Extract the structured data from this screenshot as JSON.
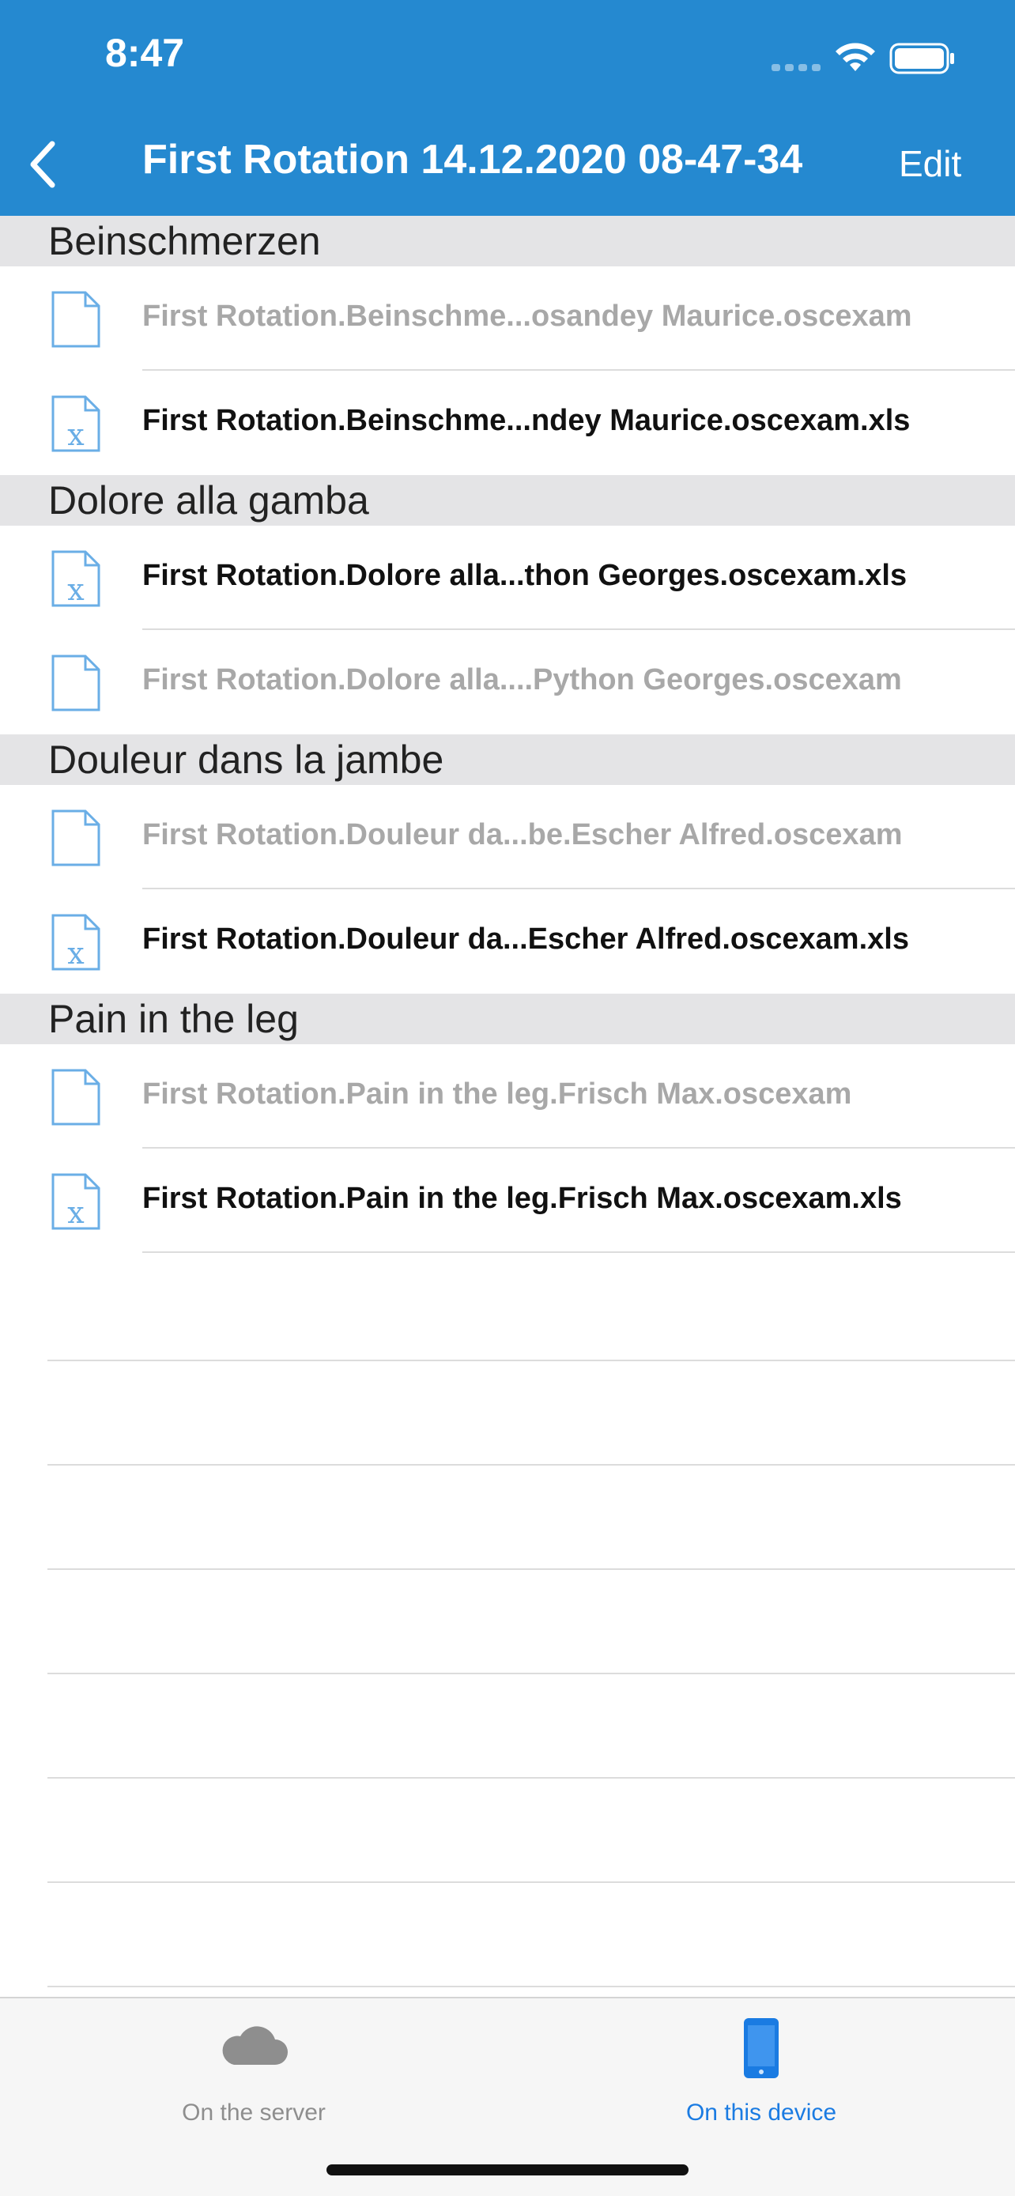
{
  "status": {
    "time": "8:47"
  },
  "nav": {
    "title": "First Rotation 14.12.2020 08-47-34",
    "edit_label": "Edit"
  },
  "sections": [
    {
      "title": "Beinschmerzen",
      "files": [
        {
          "name": "First Rotation.Beinschme...osandey Maurice.oscexam",
          "type": "doc",
          "state": "dim"
        },
        {
          "name": "First Rotation.Beinschme...ndey Maurice.oscexam.xls",
          "type": "xls",
          "state": "dark"
        }
      ]
    },
    {
      "title": "Dolore alla gamba",
      "files": [
        {
          "name": "First Rotation.Dolore alla...thon Georges.oscexam.xls",
          "type": "xls",
          "state": "dark"
        },
        {
          "name": "First Rotation.Dolore alla....Python Georges.oscexam",
          "type": "doc",
          "state": "dim"
        }
      ]
    },
    {
      "title": "Douleur dans la jambe",
      "files": [
        {
          "name": "First Rotation.Douleur da...be.Escher Alfred.oscexam",
          "type": "doc",
          "state": "dim"
        },
        {
          "name": "First Rotation.Douleur da...Escher Alfred.oscexam.xls",
          "type": "xls",
          "state": "dark"
        }
      ]
    },
    {
      "title": "Pain in the leg",
      "files": [
        {
          "name": "First Rotation.Pain in the leg.Frisch Max.oscexam",
          "type": "doc",
          "state": "dim"
        },
        {
          "name": "First Rotation.Pain in the leg.Frisch Max.oscexam.xls",
          "type": "xls",
          "state": "dark"
        }
      ]
    }
  ],
  "tabs": {
    "server": {
      "label": "On the server",
      "icon": "cloud-icon",
      "active": false
    },
    "device": {
      "label": "On this device",
      "icon": "phone-icon",
      "active": true
    }
  },
  "colors": {
    "header": "#2589d0",
    "accent": "#1a7be2",
    "icon": "#6aaee6"
  }
}
